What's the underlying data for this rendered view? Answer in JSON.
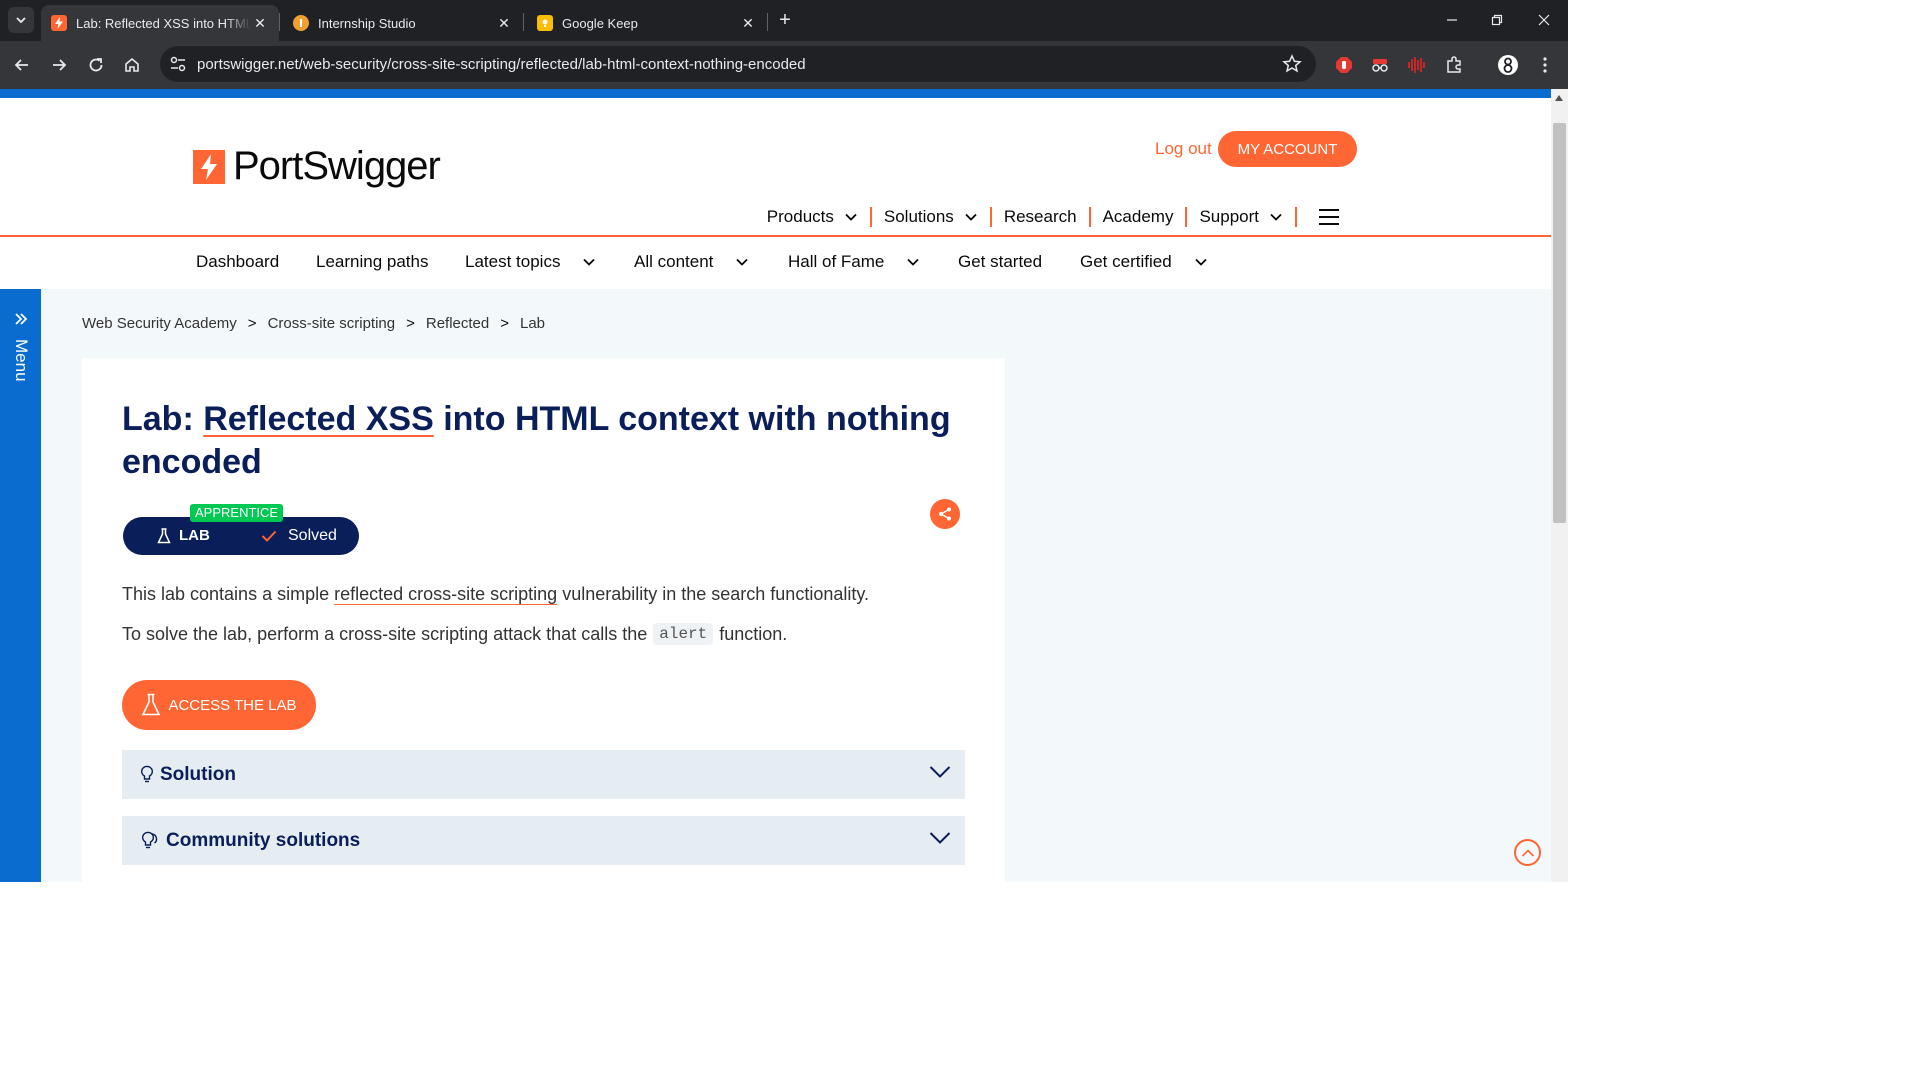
{
  "browser": {
    "tabs": [
      {
        "title": "Lab: Reflected XSS into HTML context with nothing encoded",
        "active": true,
        "favicon": "portswigger-icon"
      },
      {
        "title": "Internship Studio",
        "active": false,
        "favicon": "internship-studio-icon"
      },
      {
        "title": "Google Keep",
        "active": false,
        "favicon": "google-keep-icon"
      }
    ],
    "url": "portswigger.net/web-security/cross-site-scripting/reflected/lab-html-context-nothing-encoded"
  },
  "header": {
    "logo_text": "PortSwigger",
    "logout_label": "Log out",
    "account_label": "MY ACCOUNT",
    "main_nav": [
      {
        "label": "Products",
        "has_dropdown": true
      },
      {
        "label": "Solutions",
        "has_dropdown": true
      },
      {
        "label": "Research",
        "has_dropdown": false
      },
      {
        "label": "Academy",
        "has_dropdown": false
      },
      {
        "label": "Support",
        "has_dropdown": true
      }
    ]
  },
  "sub_nav": [
    {
      "label": "Dashboard",
      "has_dropdown": false
    },
    {
      "label": "Learning paths",
      "has_dropdown": false
    },
    {
      "label": "Latest topics",
      "has_dropdown": true
    },
    {
      "label": "All content",
      "has_dropdown": true
    },
    {
      "label": "Hall of Fame",
      "has_dropdown": true
    },
    {
      "label": "Get started",
      "has_dropdown": false
    },
    {
      "label": "Get certified",
      "has_dropdown": true
    }
  ],
  "side_menu": {
    "label": "Menu"
  },
  "breadcrumb": [
    "Web Security Academy",
    "Cross-site scripting",
    "Reflected",
    "Lab"
  ],
  "lab": {
    "title_prefix": "Lab: ",
    "title_link": "Reflected XSS",
    "title_suffix": " into HTML context with nothing encoded",
    "level": "APPRENTICE",
    "type_label": "LAB",
    "status_label": "Solved",
    "description_pre": "This lab contains a simple ",
    "description_link": "reflected cross-site scripting",
    "description_post": " vulnerability in the search functionality.",
    "task_pre": "To solve the lab, perform a cross-site scripting attack that calls the",
    "task_code": "alert",
    "task_post": "function.",
    "access_label": "ACCESS THE LAB",
    "accordions": [
      {
        "label": "Solution",
        "icon": "lightbulb-icon"
      },
      {
        "label": "Community solutions",
        "icon": "community-lightbulb-icon"
      }
    ]
  },
  "colors": {
    "brand_orange": "#ff6633",
    "navy": "#0a1e5a",
    "accent_blue": "#0a6ccf",
    "apprentice_green": "#00c853"
  }
}
